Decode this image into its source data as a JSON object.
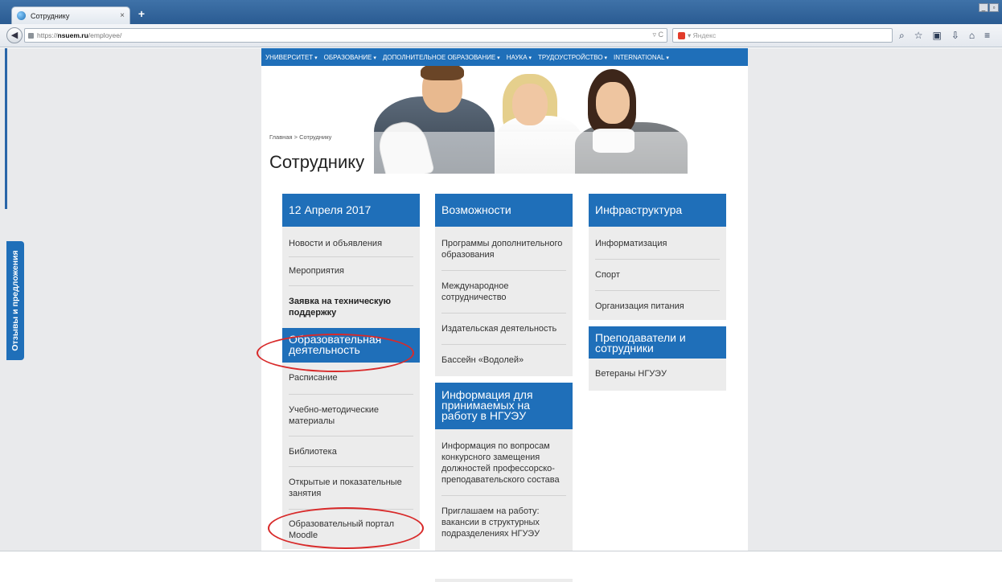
{
  "browser": {
    "tab_title": "Сотруднику",
    "tab_close": "×",
    "new_tab": "+",
    "url_prefix": "https://",
    "url_host": "nsuem.ru",
    "url_path": "/employee/",
    "url_tail": "▿ C",
    "search_placeholder": "▾ Яндекс",
    "icons": [
      "search-icon",
      "star-icon",
      "clipboard-icon",
      "download-icon",
      "home-icon",
      "menu-icon"
    ]
  },
  "feedback": {
    "label": "Отзывы и предложения"
  },
  "topnav": {
    "items": [
      "Университет",
      "Образование",
      "Дополнительное образование",
      "Наука",
      "Трудоустройство",
      "International"
    ]
  },
  "breadcrumb": "Главная > Сотруднику",
  "page_title": "Сотруднику",
  "columns": {
    "col1": {
      "header": "12 Апреля 2017",
      "items": [
        "Новости и объявления",
        "Мероприятия",
        "Заявка на техническую поддержку"
      ],
      "header2": "Образовательная деятельность",
      "items2": [
        "Расписание",
        "Учебно-методические материалы",
        "Библиотека",
        "Открытые и показательные занятия",
        "Образовательный портал Moodle"
      ]
    },
    "col2": {
      "header": "Возможности",
      "items": [
        "Программы дополнительного образования",
        "Международное сотрудничество",
        "Издательская деятельность",
        "Бассейн «Водолей»"
      ],
      "header2": "Информация для принимаемых на работу в НГУЭУ",
      "items2": [
        "Информация по вопросам конкурсного замещения должностей профессорско-преподавательского состава",
        "Приглашаем на работу: вакансии в структурных подразделениях НГУЭУ"
      ]
    },
    "col3": {
      "header": "Инфраструктура",
      "items": [
        "Информатизация",
        "Спорт",
        "Организация питания"
      ],
      "header2": "Преподаватели и сотрудники",
      "items2": [
        "Ветераны НГУЭУ"
      ]
    }
  },
  "colors": {
    "accent": "#1f6fb9",
    "highlight_ring": "#d82a2a"
  }
}
